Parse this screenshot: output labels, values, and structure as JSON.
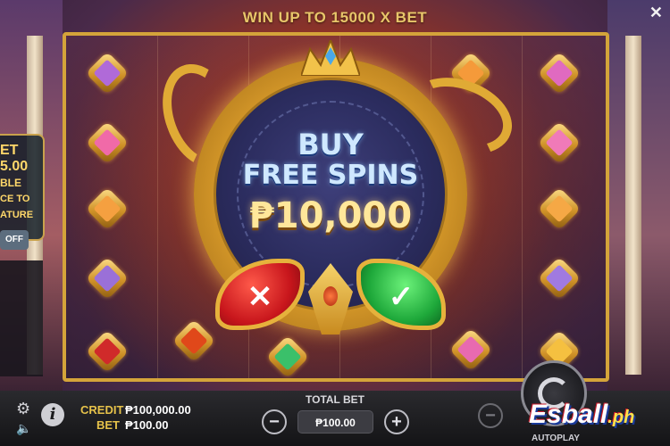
{
  "banner": {
    "text": "WIN UP TO 15000 X BET"
  },
  "side_panel": {
    "lines": [
      "ET",
      "5.00",
      "BLE",
      "CE TO",
      "ATURE"
    ],
    "toggle": "OFF"
  },
  "buy_dialog": {
    "line1": "BUY",
    "line2": "FREE SPINS",
    "price": "₱10,000",
    "cancel_glyph": "✕",
    "confirm_glyph": "✓"
  },
  "bottom": {
    "credit_label": "CREDIT",
    "credit_value": "₱100,000.00",
    "bet_label": "BET",
    "bet_value": "₱100.00",
    "total_bet_label": "TOTAL BET",
    "total_bet_value": "₱100.00",
    "minus": "−",
    "plus": "+",
    "autoplay_label": "AUTOPLAY"
  },
  "watermark": {
    "main": "Esball",
    "suffix": ".ph"
  },
  "colors": {
    "gold": "#d4a43a",
    "cancel": "#c8161c",
    "confirm": "#1ea83a",
    "label": "#e6c24a"
  }
}
